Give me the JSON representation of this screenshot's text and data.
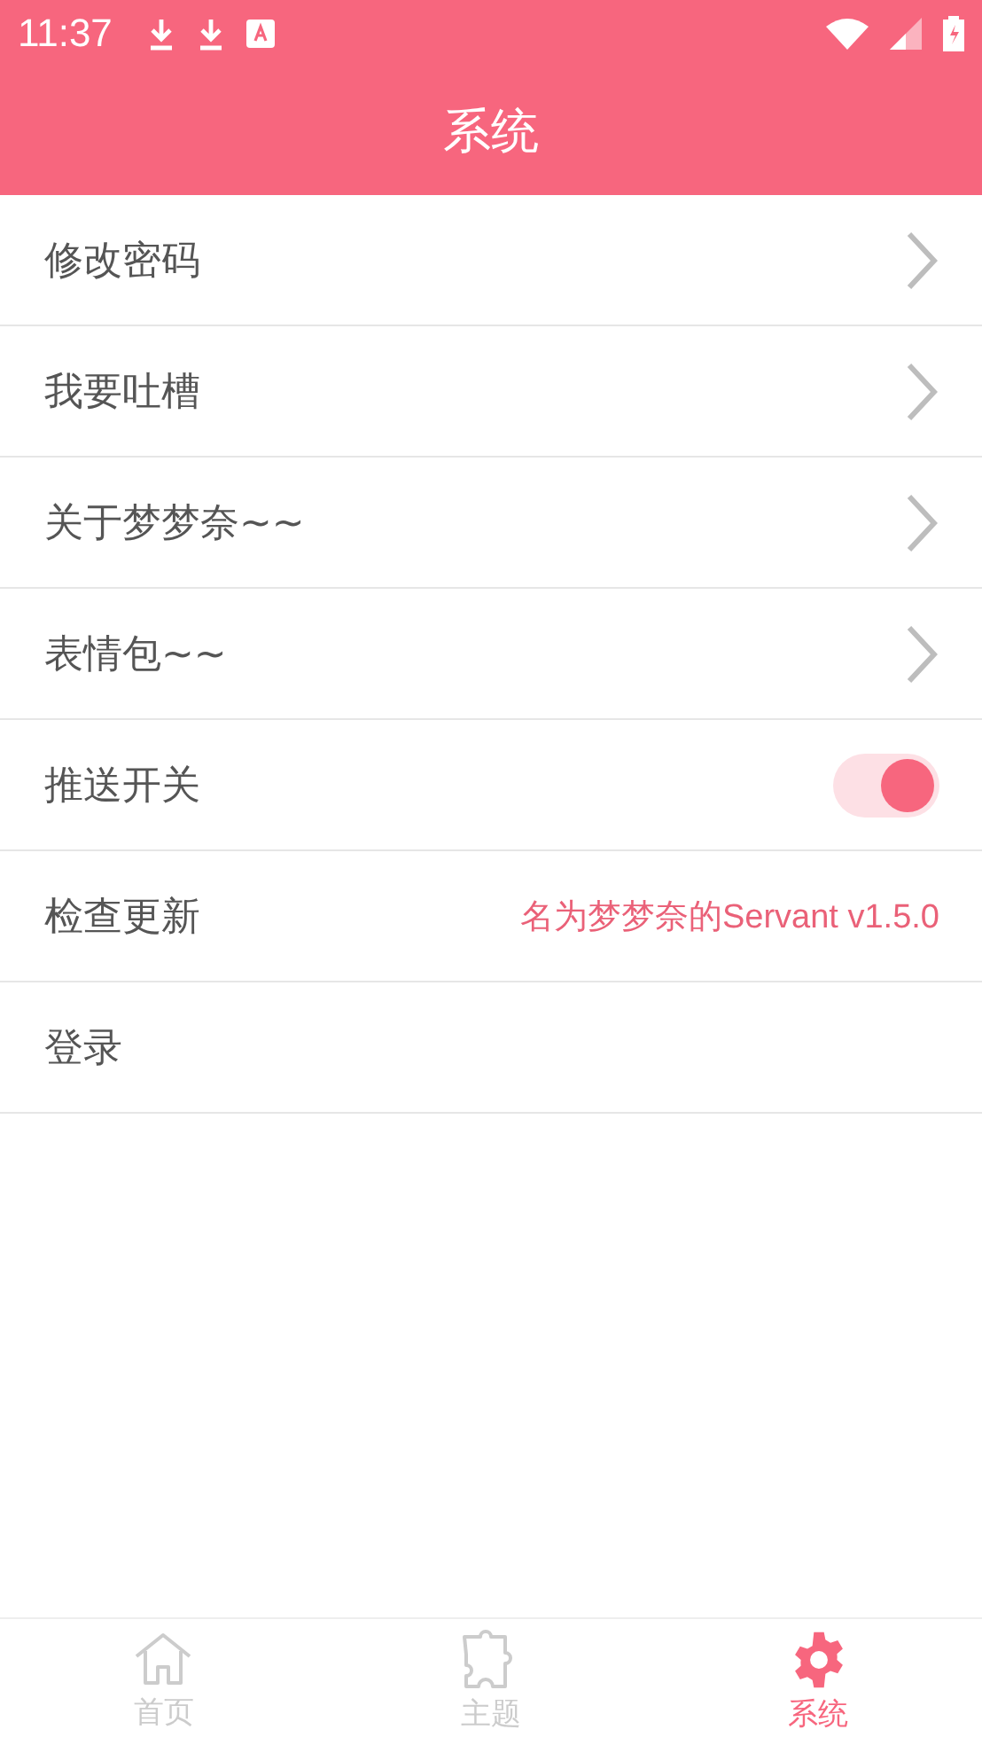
{
  "status_bar": {
    "time": "11:37"
  },
  "header": {
    "title": "系统"
  },
  "rows": [
    {
      "kind": "link",
      "label": "修改密码"
    },
    {
      "kind": "link",
      "label": "我要吐槽"
    },
    {
      "kind": "link",
      "label": "关于梦梦奈~~"
    },
    {
      "kind": "link",
      "label": "表情包~~"
    },
    {
      "kind": "toggle",
      "label": "推送开关",
      "on": true
    },
    {
      "kind": "value",
      "label": "检查更新",
      "value": "名为梦梦奈的Servant v1.5.0"
    },
    {
      "kind": "plain",
      "label": "登录"
    }
  ],
  "nav": [
    {
      "kind": "home",
      "label": "首页",
      "selected": false
    },
    {
      "kind": "puzzle",
      "label": "主题",
      "selected": false
    },
    {
      "kind": "gear",
      "label": "系统",
      "selected": true
    }
  ]
}
